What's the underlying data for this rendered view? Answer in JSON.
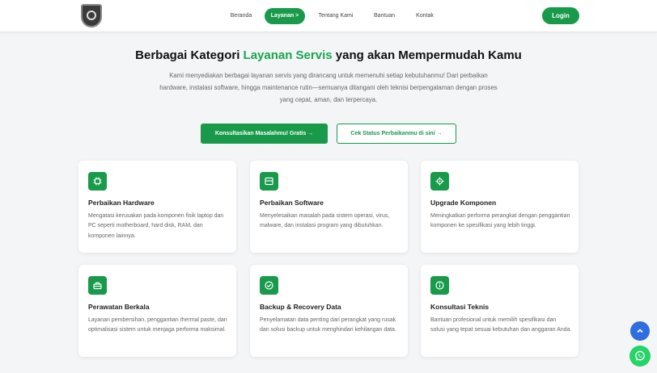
{
  "nav": {
    "links": [
      "Beranda",
      "Layanan >",
      "Tentang Kami",
      "Bantuan",
      "Kontak"
    ],
    "login_label": "Login"
  },
  "hero": {
    "title_before": "Berbagai Kategori ",
    "title_accent": "Layanan Servis",
    "title_after": " yang akan Mempermudah Kamu",
    "description": "Kami menyediakan berbagai layanan servis yang dirancang untuk memenuhi setiap kebutuhanmu! Dari perbaikan hardware, instalasi software, hingga maintenance rutin—semuanya ditangani oleh teknisi berpengalaman dengan proses yang cepat, aman, dan terpercaya.",
    "primary_button": "Konsultasikan Masalahmu! Gratis →",
    "secondary_button": "Cek Status Perbaikanmu di sini →"
  },
  "cards": [
    {
      "icon": "chip-icon",
      "title": "Perbaikan Hardware",
      "desc": "Mengatasi kerusakan pada komponen fisik laptop dan PC seperti motherboard, hard disk, RAM, dan komponen lainnya."
    },
    {
      "icon": "window-icon",
      "title": "Perbaikan Software",
      "desc": "Menyelesaikan masalah pada sistem operasi, virus, malware, dan instalasi program yang dibutuhkan."
    },
    {
      "icon": "gear-icon",
      "title": "Upgrade Komponen",
      "desc": "Meningkatkan performa perangkat dengan penggantian komponen ke spesifikasi yang lebih tinggi."
    },
    {
      "icon": "toolbox-icon",
      "title": "Perawatan Berkala",
      "desc": "Layanan pembersihan, penggantian thermal paste, dan optimalisasi sistem untuk menjaga performa maksimal."
    },
    {
      "icon": "check-circle-icon",
      "title": "Backup & Recovery Data",
      "desc": "Penyelamatan data penting dari perangkat yang rusak dan solusi backup untuk menghindari kehilangan data."
    },
    {
      "icon": "info-icon",
      "title": "Konsultasi Teknis",
      "desc": "Bantuan profesional untuk memilih spesifikasi dan solusi yang tepat sesuai kebutuhan dan anggaran Anda."
    }
  ],
  "colors": {
    "brand": "#189a4a",
    "accent_text": "#1aa64f",
    "scroll_top_button": "#2f6de0",
    "whatsapp_button": "#25d366"
  }
}
